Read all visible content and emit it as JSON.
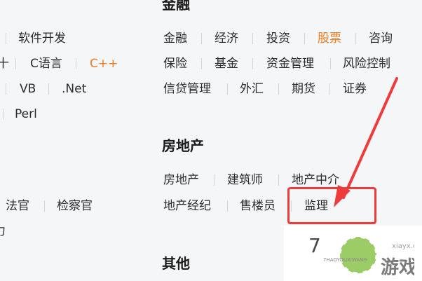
{
  "headings": {
    "finance": "金融",
    "realestate": "房地产",
    "other": "其他"
  },
  "left_column": {
    "row1": {
      "software_dev": "软件开发"
    },
    "row2": {
      "frag": "十",
      "c_lang": "C语言",
      "cpp": "C++"
    },
    "row3": {
      "vb": "VB",
      "dotnet": ".Net"
    },
    "row4": {
      "perl": "Perl"
    },
    "row5": {
      "judge": "法官",
      "prosecutor": "检察官"
    },
    "row6": {
      "frag": "力"
    }
  },
  "finance_items": {
    "jinrong": "金融",
    "jingji": "经济",
    "touzi": "投资",
    "gupiao": "股票",
    "zixun": "咨询",
    "baoxian": "保险",
    "jijin": "基金",
    "zijinguanli": "资金管理",
    "fengxiankongzhi": "风险控制",
    "xindaiguanli": "信贷管理",
    "waihui": "外汇",
    "qihuo": "期货",
    "zhengquan": "证券"
  },
  "realestate_items": {
    "fangdichan": "房地产",
    "jianzhushi": "建筑师",
    "dichanzhongjie": "地产中介",
    "dichanjingji": "地产经纪",
    "shouloyuan": "售楼员",
    "jianli": "监理"
  },
  "colors": {
    "active": "#f07a1e",
    "annotation_red": "#ee3b3b"
  },
  "watermark": {
    "number": "7",
    "url": "xiayx.com",
    "pinyin": "7HAOYOUXIWANG",
    "cn": "游戏"
  },
  "states": {
    "active_item": "gupiao",
    "highlighted_item": "jianli"
  }
}
